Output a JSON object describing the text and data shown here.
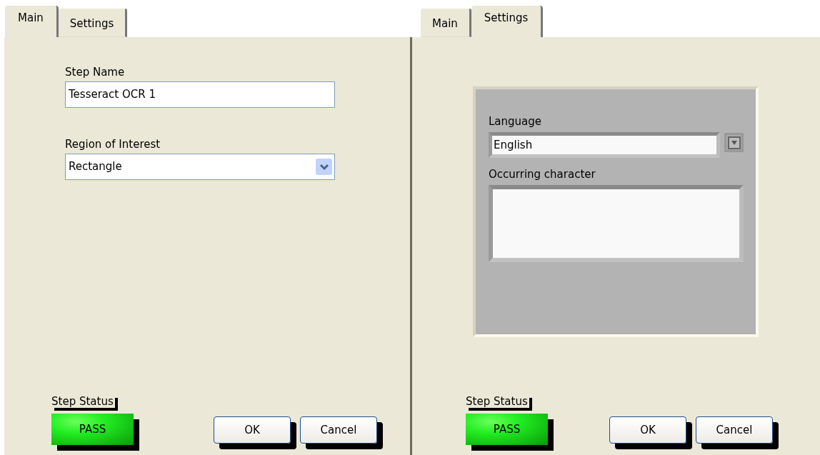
{
  "panels": [
    {
      "tabs": [
        {
          "label": "Main",
          "selected": true
        },
        {
          "label": "Settings",
          "selected": false
        }
      ],
      "fields": [
        {
          "kind": "text",
          "label": "Step Name",
          "value": "Tesseract OCR 1"
        },
        {
          "kind": "dropdown",
          "label": "Region of Interest",
          "value": "Rectangle"
        }
      ],
      "step_status": {
        "label": "Step Status",
        "value": "PASS"
      },
      "buttons": [
        "OK",
        "Cancel"
      ]
    },
    {
      "tabs": [
        {
          "label": "Main",
          "selected": false
        },
        {
          "label": "Settings",
          "selected": true
        }
      ],
      "group": {
        "fields": [
          {
            "kind": "combo",
            "label": "Language",
            "value": "English"
          },
          {
            "kind": "textarea",
            "label": "Occurring character"
          }
        ]
      },
      "step_status": {
        "label": "Step Status",
        "value": "PASS"
      },
      "buttons": [
        "OK",
        "Cancel"
      ]
    }
  ]
}
